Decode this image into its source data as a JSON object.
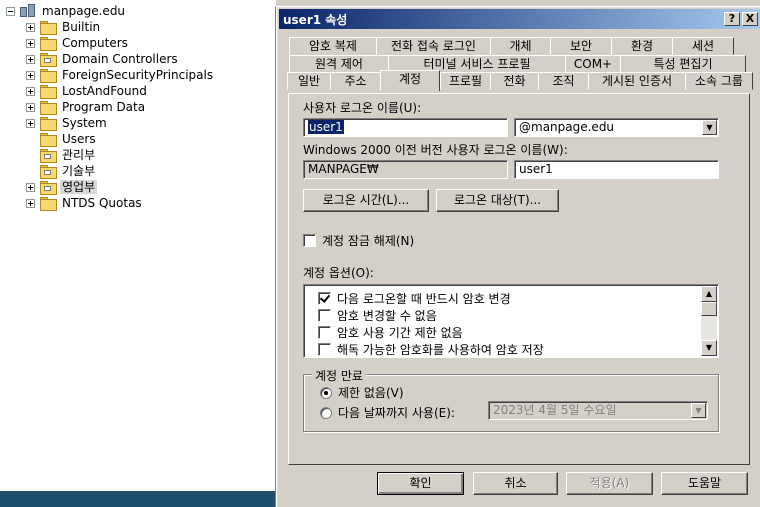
{
  "tree": {
    "root": "manpage.edu",
    "items": [
      {
        "label": "Builtin",
        "expand": "plus"
      },
      {
        "label": "Computers",
        "expand": "plus"
      },
      {
        "label": "Domain Controllers",
        "expand": "plus"
      },
      {
        "label": "ForeignSecurityPrincipals",
        "expand": "plus"
      },
      {
        "label": "LostAndFound",
        "expand": "plus"
      },
      {
        "label": "Program Data",
        "expand": "plus"
      },
      {
        "label": "System",
        "expand": "plus"
      },
      {
        "label": "Users",
        "expand": "none"
      },
      {
        "label": "관리부",
        "expand": "none"
      },
      {
        "label": "기술부",
        "expand": "none"
      },
      {
        "label": "영업부",
        "expand": "plus"
      },
      {
        "label": "NTDS Quotas",
        "expand": "plus"
      }
    ]
  },
  "dialog": {
    "title": "user1 속성",
    "help_button": "?",
    "close_button": "X",
    "tabs": {
      "row1": [
        "암호 복제",
        "전화 접속 로그인",
        "개체",
        "보안",
        "환경",
        "세션"
      ],
      "row2": [
        "원격 제어",
        "터미널 서비스 프로필",
        "COM+",
        "특성 편집기"
      ],
      "row3": [
        "일반",
        "주소",
        "계정",
        "프로필",
        "전화",
        "조직",
        "게시된 인증서",
        "소속 그룹"
      ]
    },
    "logon_name_label": "사용자 로그온 이름(U):",
    "logon_name_value": "user1",
    "domain_suffix": "@manpage.edu",
    "pre2000_label": "Windows 2000 이전 버전 사용자 로그온 이름(W):",
    "pre2000_domain": "MANPAGE₩",
    "pre2000_name": "user1",
    "logon_hours_button": "로그온 시간(L)...",
    "logon_to_button": "로그온 대상(T)...",
    "unlock_label": "계정 잠금 해제(N)",
    "account_options_label": "계정 옵션(O):",
    "account_options": [
      {
        "label": "다음 로그온할 때 반드시 암호 변경",
        "checked": true
      },
      {
        "label": "암호 변경할 수 없음",
        "checked": false
      },
      {
        "label": "암호 사용 기간 제한 없음",
        "checked": false
      },
      {
        "label": "해독 가능한 암호화를 사용하여 암호 저장",
        "checked": false
      }
    ],
    "expires_group": "계정 만료",
    "never_label": "제한 없음(V)",
    "end_of_label": "다음 날짜까지 사용(E):",
    "date_value": "2023년   4월   5일 수요일",
    "buttons": {
      "ok": "확인",
      "cancel": "취소",
      "apply": "적용(A)",
      "help": "도움말"
    }
  }
}
